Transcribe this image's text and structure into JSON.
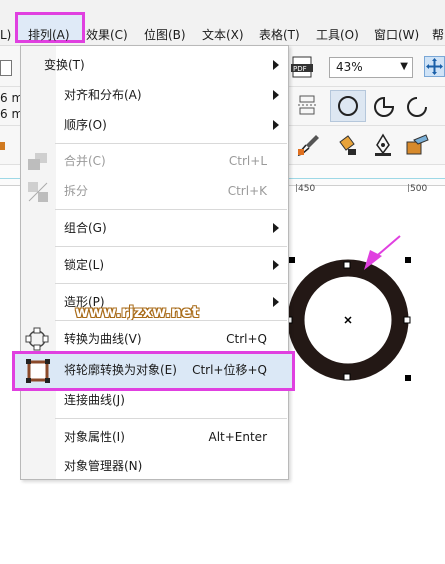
{
  "menubar": {
    "items": [
      {
        "label": "L)"
      },
      {
        "label": "排列(A)"
      },
      {
        "label": "效果(C)"
      },
      {
        "label": "位图(B)"
      },
      {
        "label": "文本(X)"
      },
      {
        "label": "表格(T)"
      },
      {
        "label": "工具(O)"
      },
      {
        "label": "窗口(W)"
      },
      {
        "label": "帮"
      }
    ]
  },
  "left_toolbar": {
    "values": [
      "6 m",
      "6 m"
    ]
  },
  "toolbar": {
    "zoom": "43%"
  },
  "ruler": {
    "labels": [
      "450",
      "500"
    ]
  },
  "menu": {
    "items": [
      {
        "label": "变换(T)",
        "shortcut": "",
        "submenu": true,
        "disabled": false
      },
      {
        "label": "对齐和分布(A)",
        "shortcut": "",
        "submenu": true,
        "disabled": false
      },
      {
        "label": "顺序(O)",
        "shortcut": "",
        "submenu": true,
        "disabled": false
      },
      {
        "label": "合并(C)",
        "shortcut": "Ctrl+L",
        "submenu": false,
        "disabled": true
      },
      {
        "label": "拆分",
        "shortcut": "Ctrl+K",
        "submenu": false,
        "disabled": true
      },
      {
        "label": "组合(G)",
        "shortcut": "",
        "submenu": true,
        "disabled": false
      },
      {
        "label": "锁定(L)",
        "shortcut": "",
        "submenu": true,
        "disabled": false
      },
      {
        "label": "造形(P)",
        "shortcut": "",
        "submenu": true,
        "disabled": false
      },
      {
        "label": "转换为曲线(V)",
        "shortcut": "Ctrl+Q",
        "submenu": false,
        "disabled": false
      },
      {
        "label": "将轮廓转换为对象(E)",
        "shortcut": "Ctrl+位移+Q",
        "submenu": false,
        "disabled": false,
        "highlighted": true
      },
      {
        "label": "连接曲线(J)",
        "shortcut": "",
        "submenu": false,
        "disabled": false
      },
      {
        "label": "对象属性(I)",
        "shortcut": "Alt+Enter",
        "submenu": false,
        "disabled": false
      },
      {
        "label": "对象管理器(N)",
        "shortcut": "",
        "submenu": false,
        "disabled": false
      }
    ]
  },
  "watermark": "www.rjzxw.net",
  "colors": {
    "highlight_border": "#e040e0",
    "menu_hover": "#dbe8f6",
    "ring": "#231815",
    "arrow": "#e040e0"
  }
}
